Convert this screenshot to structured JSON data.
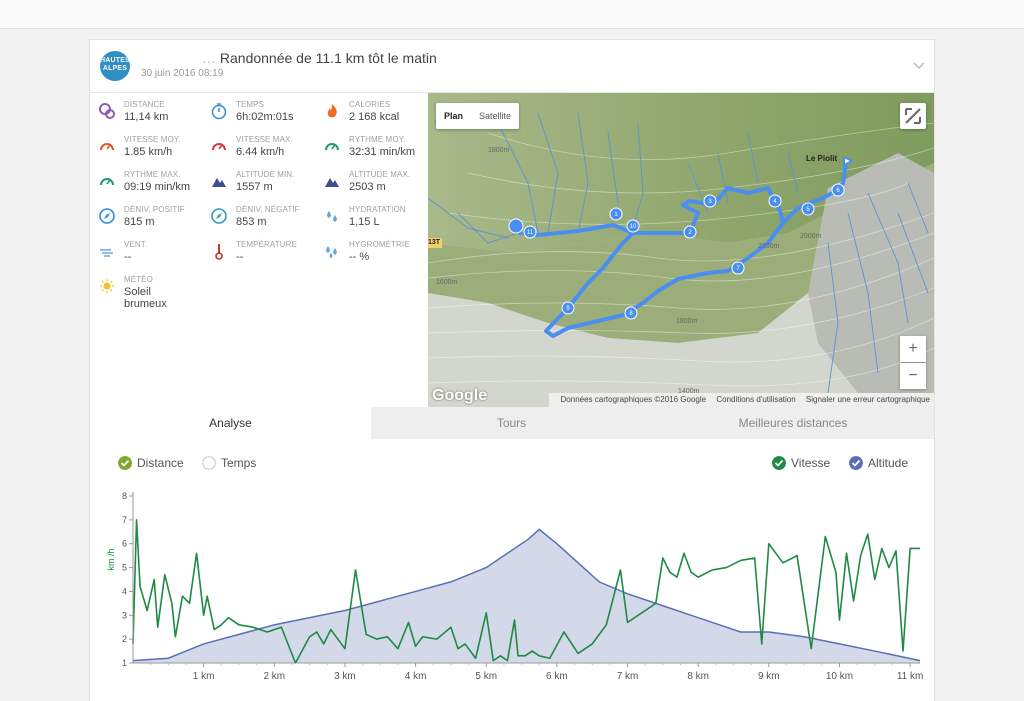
{
  "activity": {
    "title_prefix": "…",
    "title": "Randonnée de 11.1 km tôt le matin",
    "date": "30 juin 2016 08:19",
    "logo_text": "HAUTES ALPES"
  },
  "stats": [
    {
      "label": "DISTANCE",
      "value": "11,14 km",
      "icon": "distance-icon",
      "color": "#8e5bb3"
    },
    {
      "label": "TEMPS",
      "value": "6h:02m:01s",
      "icon": "stopwatch-icon",
      "color": "#3f8fd6"
    },
    {
      "label": "CALORIES",
      "value": "2 168 kcal",
      "icon": "flame-icon",
      "color": "#f26a2a"
    },
    {
      "label": "VITESSE MOY.",
      "value": "1.85 km/h",
      "icon": "speedometer-icon",
      "color": "#e5532d"
    },
    {
      "label": "VITESSE MAX.",
      "value": "6.44 km/h",
      "icon": "speedometer-icon",
      "color": "#d93a3a"
    },
    {
      "label": "RYTHME MOY.",
      "value": "32:31 min/km",
      "icon": "speedometer-icon",
      "color": "#1f9a6a"
    },
    {
      "label": "RYTHME MAX.",
      "value": "09:19 min/km",
      "icon": "speedometer-icon",
      "color": "#1f9a6a"
    },
    {
      "label": "ALTITUDE MIN.",
      "value": "1557 m",
      "icon": "mountain-icon",
      "color": "#3c4f8f"
    },
    {
      "label": "ALTITUDE MAX.",
      "value": "2503 m",
      "icon": "mountain-icon",
      "color": "#3c4f8f"
    },
    {
      "label": "DÉNIV. POSITIF",
      "value": "815 m",
      "icon": "compass-icon",
      "color": "#2f8fd6"
    },
    {
      "label": "DÉNIV. NÉGATIF",
      "value": "853 m",
      "icon": "compass-icon",
      "color": "#2aa0b0"
    },
    {
      "label": "HYDRATATION",
      "value": "1,15 L",
      "icon": "water-drops-icon",
      "color": "#5fa3e0"
    },
    {
      "label": "VENT",
      "value": "--",
      "icon": "wind-icon",
      "color": "#6aa9e0"
    },
    {
      "label": "TEMPÉRATURE",
      "value": "--",
      "icon": "thermometer-icon",
      "color": "#c0392b"
    },
    {
      "label": "HYGROMÉTRIE",
      "value": "-- %",
      "icon": "humidity-icon",
      "color": "#6aa9e0"
    },
    {
      "label": "MÉTÉO",
      "value": "Soleil brumeux",
      "icon": "sun-haze-icon",
      "color": "#f2c230"
    }
  ],
  "map": {
    "type_buttons": [
      "Plan",
      "Satellite"
    ],
    "zoom_in": "+",
    "zoom_out": "−",
    "attribution": "Données cartographiques ©2016 Google",
    "terms": "Conditions d'utilisation",
    "report": "Signaler une erreur cartographique",
    "google_label": "Google",
    "place_label": "Le Piolit",
    "road_label": "13T",
    "contour_labels": [
      "1800m",
      "2000m",
      "2200m",
      "1800m",
      "1600m",
      "1400m"
    ],
    "markers": [
      "1",
      "2",
      "3",
      "4",
      "5",
      "6",
      "7",
      "8",
      "9",
      "10",
      "11"
    ],
    "route_color": "#4a8ff0"
  },
  "tabs": [
    "Analyse",
    "Tours",
    "Meilleures distances"
  ],
  "toggles": {
    "left": [
      {
        "label": "Distance",
        "checked": true,
        "color": "#7fa82a"
      },
      {
        "label": "Temps",
        "checked": false,
        "color": "#cccccc"
      }
    ],
    "right": [
      {
        "label": "Vitesse",
        "checked": true,
        "color": "#1e8a44"
      },
      {
        "label": "Altitude",
        "checked": true,
        "color": "#5a6fb8"
      }
    ]
  },
  "chart_data": {
    "type": "line",
    "ylabel": "km /h",
    "ylim": [
      1,
      8
    ],
    "yticks": [
      "1",
      "2",
      "3",
      "4",
      "5",
      "6",
      "7",
      "8"
    ],
    "xlim": [
      0,
      11.14
    ],
    "xticks": [
      "1 km",
      "2 km",
      "3 km",
      "4 km",
      "5 km",
      "6 km",
      "7 km",
      "8 km",
      "9 km",
      "10 km",
      "11 km"
    ],
    "grid": false,
    "series": [
      {
        "name": "Vitesse",
        "color": "#1e8a44",
        "x": [
          0,
          0.05,
          0.1,
          0.2,
          0.3,
          0.35,
          0.45,
          0.55,
          0.6,
          0.7,
          0.8,
          0.9,
          1.0,
          1.05,
          1.15,
          1.25,
          1.35,
          1.5,
          1.7,
          1.9,
          2.1,
          2.3,
          2.5,
          2.6,
          2.7,
          2.8,
          3.0,
          3.15,
          3.3,
          3.45,
          3.6,
          3.75,
          3.9,
          4.0,
          4.1,
          4.3,
          4.5,
          4.6,
          4.7,
          4.85,
          5.0,
          5.1,
          5.2,
          5.3,
          5.4,
          5.45,
          5.55,
          5.65,
          5.75,
          5.9,
          6.1,
          6.3,
          6.5,
          6.7,
          6.9,
          7.0,
          7.2,
          7.4,
          7.5,
          7.6,
          7.7,
          7.8,
          7.9,
          8.0,
          8.2,
          8.4,
          8.6,
          8.8,
          8.9,
          9.0,
          9.2,
          9.4,
          9.6,
          9.8,
          9.95,
          10.0,
          10.1,
          10.2,
          10.3,
          10.4,
          10.5,
          10.6,
          10.7,
          10.8,
          10.9,
          11.0,
          11.14
        ],
        "values": [
          1.8,
          7.0,
          4.2,
          3.2,
          4.5,
          2.5,
          4.7,
          3.5,
          2.1,
          3.8,
          3.5,
          5.6,
          3.0,
          3.8,
          2.4,
          2.6,
          2.9,
          2.6,
          2.5,
          2.3,
          2.5,
          1.0,
          2.1,
          2.3,
          1.8,
          2.4,
          1.6,
          4.9,
          2.2,
          2.0,
          2.1,
          1.6,
          2.7,
          1.7,
          2.1,
          2.0,
          2.5,
          1.6,
          1.8,
          1.2,
          3.1,
          1.1,
          1.3,
          1.1,
          2.8,
          1.3,
          1.3,
          1.5,
          1.3,
          1.2,
          2.3,
          1.4,
          1.8,
          2.6,
          4.9,
          2.7,
          3.1,
          3.5,
          5.4,
          4.8,
          4.6,
          5.6,
          4.8,
          4.6,
          4.9,
          5.0,
          5.3,
          5.4,
          1.8,
          6.0,
          5.2,
          5.5,
          1.6,
          6.3,
          4.8,
          2.8,
          5.6,
          3.6,
          5.5,
          6.4,
          4.5,
          5.8,
          5.0,
          5.7,
          1.5,
          5.8,
          5.8
        ]
      },
      {
        "name": "Altitude",
        "color": "#5a6fb8",
        "fill": "#d4d9e9",
        "x": [
          0,
          0.5,
          1.0,
          1.5,
          2.0,
          2.5,
          3.0,
          3.5,
          4.0,
          4.5,
          5.0,
          5.3,
          5.6,
          5.75,
          6.0,
          6.3,
          6.6,
          7.0,
          7.5,
          8.0,
          8.3,
          8.6,
          9.0,
          9.5,
          10.0,
          10.5,
          11.14
        ],
        "values": [
          1.1,
          1.2,
          1.8,
          2.2,
          2.6,
          2.9,
          3.2,
          3.6,
          4.0,
          4.4,
          5.0,
          5.6,
          6.2,
          6.6,
          6.0,
          5.2,
          4.4,
          3.9,
          3.4,
          2.9,
          2.6,
          2.3,
          2.3,
          2.1,
          1.8,
          1.5,
          1.1
        ]
      }
    ]
  }
}
